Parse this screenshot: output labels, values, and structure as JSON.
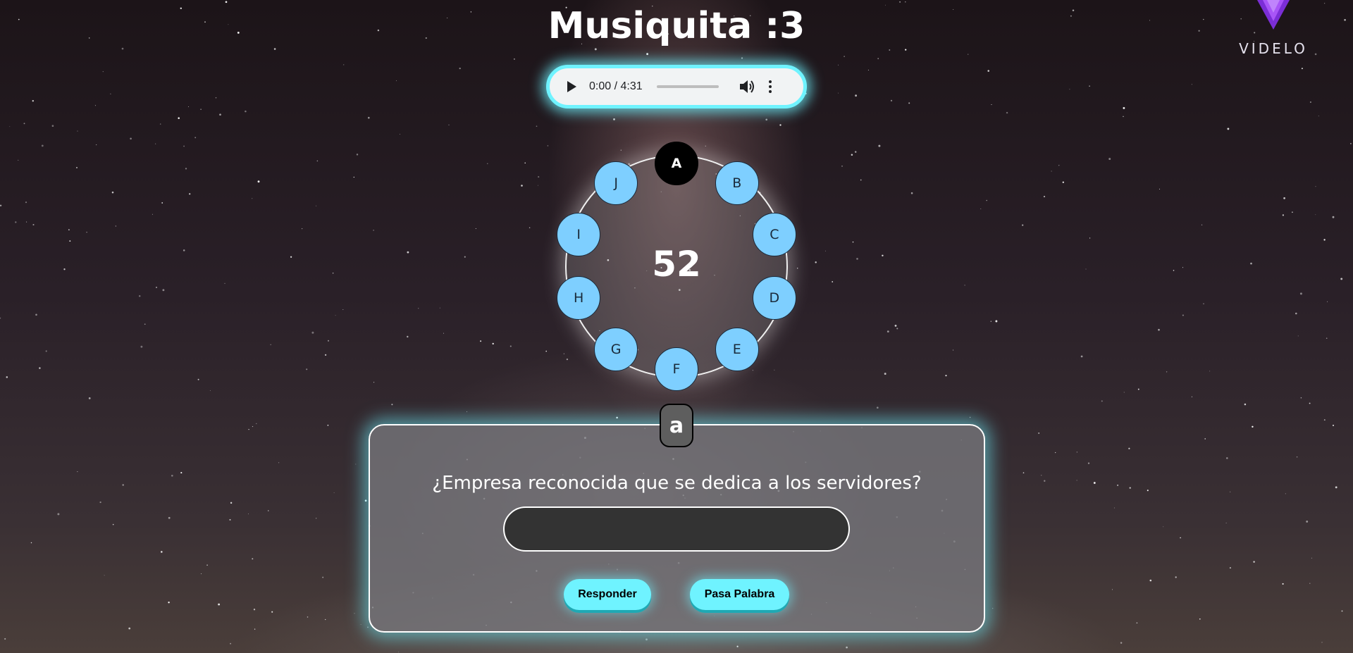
{
  "header": {
    "title": "Musiquita :3",
    "logo_text": "VIDELO",
    "logo_icon": "videlo-v-logo"
  },
  "audio": {
    "time": "0:00 / 4:31",
    "play_icon": "play-icon",
    "volume_icon": "volume-icon",
    "more_icon": "more-vertical-icon",
    "progress": 0
  },
  "wheel": {
    "counter": "52",
    "letters": [
      "A",
      "B",
      "C",
      "D",
      "E",
      "F",
      "G",
      "H",
      "I",
      "J"
    ],
    "active_letter": "A"
  },
  "question_panel": {
    "current_letter": "a",
    "question": "¿Empresa reconocida que se dedica a los servidores?",
    "answer_value": "",
    "answer_placeholder": "",
    "answer_button": "Responder",
    "pass_button": "Pasa Palabra"
  },
  "colors": {
    "accent": "#6ff3ff",
    "letter_bubble": "#7ecfff",
    "active_letter": "#000000",
    "panel": "#78787d",
    "logo_purple": "#8a2be2"
  }
}
